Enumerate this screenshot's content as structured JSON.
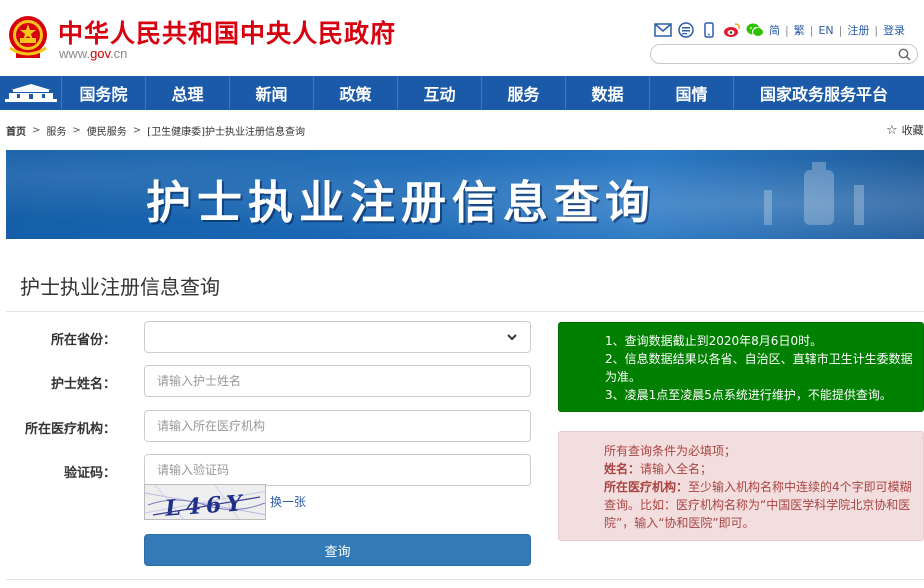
{
  "header": {
    "site_title": "中华人民共和国中央人民政府",
    "domain_prefix": "www.",
    "domain_mid": "gov",
    "domain_suffix": ".cn",
    "links": [
      "简",
      "繁",
      "EN",
      "注册",
      "登录"
    ],
    "icons": [
      "mail-icon",
      "app-icon",
      "mobile-icon",
      "weibo-icon",
      "wechat-icon"
    ]
  },
  "nav": {
    "items": [
      "国务院",
      "总理",
      "新闻",
      "政策",
      "互动",
      "服务",
      "数据",
      "国情",
      "国家政务服务平台"
    ]
  },
  "breadcrumb": {
    "items": [
      "首页",
      "服务",
      "便民服务",
      "[卫生健康委]护士执业注册信息查询"
    ],
    "favorite": "收藏"
  },
  "banner": {
    "title": "护士执业注册信息查询"
  },
  "page": {
    "heading": "护士执业注册信息查询"
  },
  "form": {
    "province": {
      "label": "所在省份：",
      "value": ""
    },
    "name": {
      "label": "护士姓名：",
      "placeholder": "请输入护士姓名"
    },
    "org": {
      "label": "所在医疗机构：",
      "placeholder": "请输入所在医疗机构"
    },
    "code": {
      "label": "验证码：",
      "placeholder": "请输入验证码"
    },
    "captcha_text": "L46Y",
    "refresh": "换一张",
    "submit": "查询"
  },
  "notice_green": {
    "lines": [
      "1、查询数据截止到2020年8月6日0时。",
      "2、信息数据结果以各省、自治区、直辖市卫生计生委数据为准。",
      "3、凌晨1点至凌晨5点系统进行维护，不能提供查询。"
    ]
  },
  "notice_red": {
    "line1": "所有查询条件为必填项；",
    "name_key": "姓名：",
    "name_text": "请输入全名；",
    "org_key": "所在医疗机构：",
    "org_text": "至少输入机构名称中连续的4个字即可模糊查询。比如：医疗机构名称为“中国医学科学院北京协和医院”，输入“协和医院”即可。"
  },
  "colors": {
    "brand_red": "#d7000f",
    "nav_blue": "#1b5aa8",
    "button_blue": "#337ab7",
    "notice_green": "#008000",
    "notice_red_bg": "#f2dede",
    "notice_red_text": "#a94442"
  }
}
